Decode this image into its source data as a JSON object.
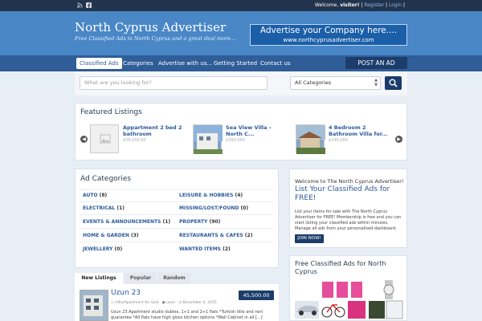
{
  "topbar": {
    "social_icons": [
      "rss-icon",
      "facebook-icon"
    ],
    "welcome_text": "Welcome,",
    "user": "visitor!",
    "register_label": "Register",
    "login_label": "Login"
  },
  "header": {
    "title": "North Cyprus Advertiser",
    "tagline": "Free Classified Ads in North Cyprus and a great deal more...",
    "banner_line1": "Advertise your Company here....",
    "banner_line2": "www.northcyprusadvertiser.com"
  },
  "nav": {
    "items": [
      "Classified Ads",
      "Categories",
      "Advertise with us...",
      "Getting Started",
      "Contact us"
    ],
    "post_ad_label": "POST AN AD"
  },
  "search": {
    "placeholder": "What are you looking for?",
    "category_selected": "All Categories"
  },
  "featured": {
    "title": "Featured Listings",
    "items": [
      {
        "title": "Appartment 2 bed 2 bathroom",
        "price": "£58,000.00"
      },
      {
        "title": "Sea View Villa – North C...",
        "price": "£350,000"
      },
      {
        "title": "4 Bedroom 2 Bathroom Villa for...",
        "price": "£145,000"
      }
    ]
  },
  "ad_categories": {
    "title": "Ad Categories",
    "left": [
      {
        "name": "Auto",
        "count": "(8)"
      },
      {
        "name": "Electrical",
        "count": "(1)"
      },
      {
        "name": "Events & Announcements",
        "count": "(1)"
      },
      {
        "name": "Home & Garden",
        "count": "(3)"
      },
      {
        "name": "Jewellery",
        "count": "(0)"
      }
    ],
    "right": [
      {
        "name": "Leisure & Hobbies",
        "count": "(4)"
      },
      {
        "name": "Missing/Lost/Found",
        "count": "(0)"
      },
      {
        "name": "Property",
        "count": "(90)"
      },
      {
        "name": "Restaurants & Cafes",
        "count": "(2)"
      },
      {
        "name": "Wanted Items",
        "count": "(2)"
      }
    ]
  },
  "welcome": {
    "small": "Welcome to The North Cyprus Advertiser!",
    "big": "List Your Classified Ads for FREE!",
    "body": "List your items for sale with The North Cyprus Advertiser for FREE! Membership is free and you can start listing your classified ads within minutes. Manage all ads from your personalised dashboard.",
    "button": "JOIN NOW!"
  },
  "free_ads": {
    "title": "Free Classified Ads for North Cyprus"
  },
  "tabs": [
    "New Listings",
    "Popular",
    "Random"
  ],
  "listing": {
    "title": "Uzun 23",
    "price": "45,500.00",
    "category": "Villa/Apartment for Sale",
    "author": "uzun",
    "date": "December 4, 2015",
    "desc": "Uzun 23 Apartment studio dublex, 1+1 and 2+1 flats *Turkish title and rent guarantee *All flats have high gloss kitchen options *Wall Cabinet in all [...]"
  },
  "colors": {
    "header_blue": "#4a87c7",
    "nav_blue": "#2f5d97",
    "dark_navy": "#1c3d6b",
    "link_blue": "#2c5a9a"
  }
}
